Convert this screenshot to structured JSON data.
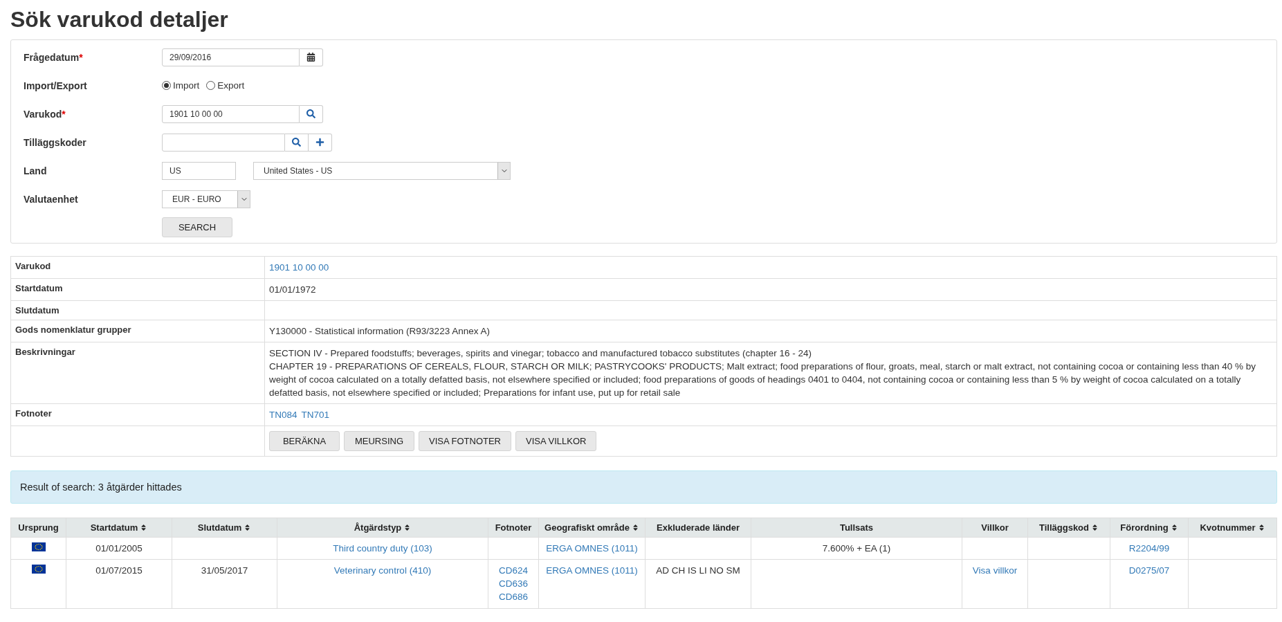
{
  "title": "Sök varukod detaljer",
  "form": {
    "query_date": {
      "label": "Frågedatum",
      "required_mark": "*",
      "value": "29/09/2016"
    },
    "direction": {
      "label": "Import/Export",
      "options": [
        {
          "label": "Import",
          "selected": true
        },
        {
          "label": "Export",
          "selected": false
        }
      ]
    },
    "code": {
      "label": "Varukod",
      "required_mark": "*",
      "value": "1901 10 00 00"
    },
    "additional_codes": {
      "label": "Tilläggskoder"
    },
    "country": {
      "label": "Land",
      "code": "US",
      "selected": "United States - US"
    },
    "currency": {
      "label": "Valutaenhet",
      "selected": "EUR - EURO"
    },
    "search_button": "SEARCH"
  },
  "details": [
    {
      "label": "Varukod",
      "kind": "link",
      "value": "1901 10 00 00"
    },
    {
      "label": "Startdatum",
      "kind": "text",
      "value": "01/01/1972"
    },
    {
      "label": "Slutdatum",
      "kind": "text"
    },
    {
      "label": "Gods nomenklatur grupper",
      "kind": "text",
      "value": "Y130000 - Statistical information (R93/3223 Annex A)"
    },
    {
      "label": "Beskrivningar",
      "kind": "paragraphs",
      "value": [
        "SECTION IV - Prepared foodstuffs; beverages, spirits and vinegar; tobacco and manufactured tobacco substitutes (chapter 16 - 24)",
        "CHAPTER 19 - PREPARATIONS OF CEREALS, FLOUR, STARCH OR MILK; PASTRYCOOKS' PRODUCTS; Malt extract; food preparations of flour, groats, meal, starch or malt extract, not containing cocoa or containing less than 40 % by weight of cocoa calculated on a totally defatted basis, not elsewhere specified or included; food preparations of goods of headings 0401 to 0404, not containing cocoa or containing less than 5 % by weight of cocoa calculated on a totally defatted basis, not elsewhere specified or included; Preparations for infant use, put up for retail sale"
      ]
    },
    {
      "label": "Fotnoter",
      "kind": "links",
      "value": [
        "TN084",
        "TN701"
      ]
    },
    {
      "kind": "buttons",
      "value": [
        "BERÄKNA",
        "MEURSING",
        "VISA FOTNOTER",
        "VISA VILLKOR"
      ]
    }
  ],
  "result_message": "Result of search: 3 åtgärder hittades",
  "results": {
    "columns": [
      {
        "label": "Ursprung",
        "sortable": false,
        "kind": "flag"
      },
      {
        "label": "Startdatum",
        "sortable": true,
        "kind": "text"
      },
      {
        "label": "Slutdatum",
        "sortable": true,
        "kind": "text"
      },
      {
        "label": "Åtgärdstyp",
        "sortable": true,
        "kind": "link"
      },
      {
        "label": "Fotnoter",
        "sortable": false,
        "kind": "links"
      },
      {
        "label": "Geografiskt område",
        "sortable": true,
        "kind": "link"
      },
      {
        "label": "Exkluderade länder",
        "sortable": false,
        "kind": "text"
      },
      {
        "label": "Tullsats",
        "sortable": false,
        "kind": "text"
      },
      {
        "label": "Villkor",
        "sortable": false,
        "kind": "link"
      },
      {
        "label": "Tilläggskod",
        "sortable": true,
        "kind": "text"
      },
      {
        "label": "Förordning",
        "sortable": true,
        "kind": "link"
      },
      {
        "label": "Kvotnummer",
        "sortable": true,
        "kind": "text"
      }
    ],
    "rows": [
      {
        "cells": [
          null,
          "01/01/2005",
          null,
          "Third country duty (103)",
          null,
          "ERGA OMNES (1011)",
          null,
          "7.600% + EA (1)",
          null,
          null,
          "R2204/99",
          null
        ]
      },
      {
        "cells": [
          null,
          "01/07/2015",
          "31/05/2017",
          "Veterinary control (410)",
          [
            "CD624",
            "CD636",
            "CD686"
          ],
          "ERGA OMNES (1011)",
          "AD CH IS LI NO SM",
          null,
          "Visa villkor",
          null,
          "D0275/07",
          null
        ]
      }
    ]
  }
}
